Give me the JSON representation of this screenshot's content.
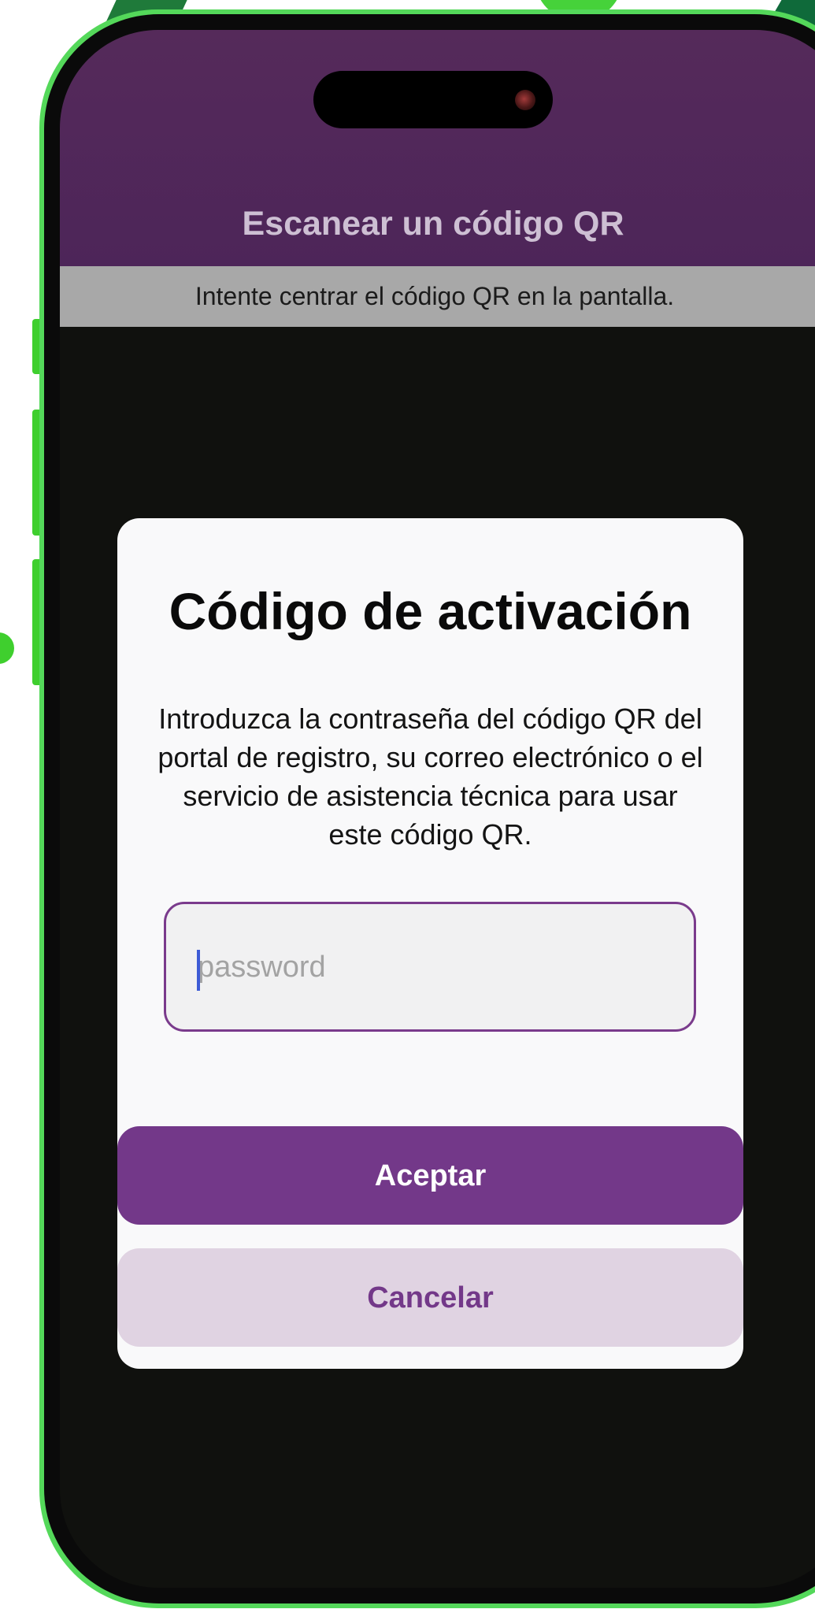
{
  "app": {
    "title": "Escanear un código QR",
    "hint": "Intente centrar el código QR en la pantalla."
  },
  "dialog": {
    "title": "Código de activación",
    "message": "Introduzca la contraseña del código QR del portal de registro, su correo electrónico o el servicio de asistencia técnica para usar este código QR.",
    "password": {
      "value": "",
      "placeholder": "password"
    },
    "accept_label": "Aceptar",
    "cancel_label": "Cancelar"
  },
  "colors": {
    "phone_frame": "#54d85a",
    "app_bar": "#552a5a",
    "accent": "#733889",
    "cancel_bg": "#e0d3e2",
    "hint_bar": "#a8a8a8"
  }
}
